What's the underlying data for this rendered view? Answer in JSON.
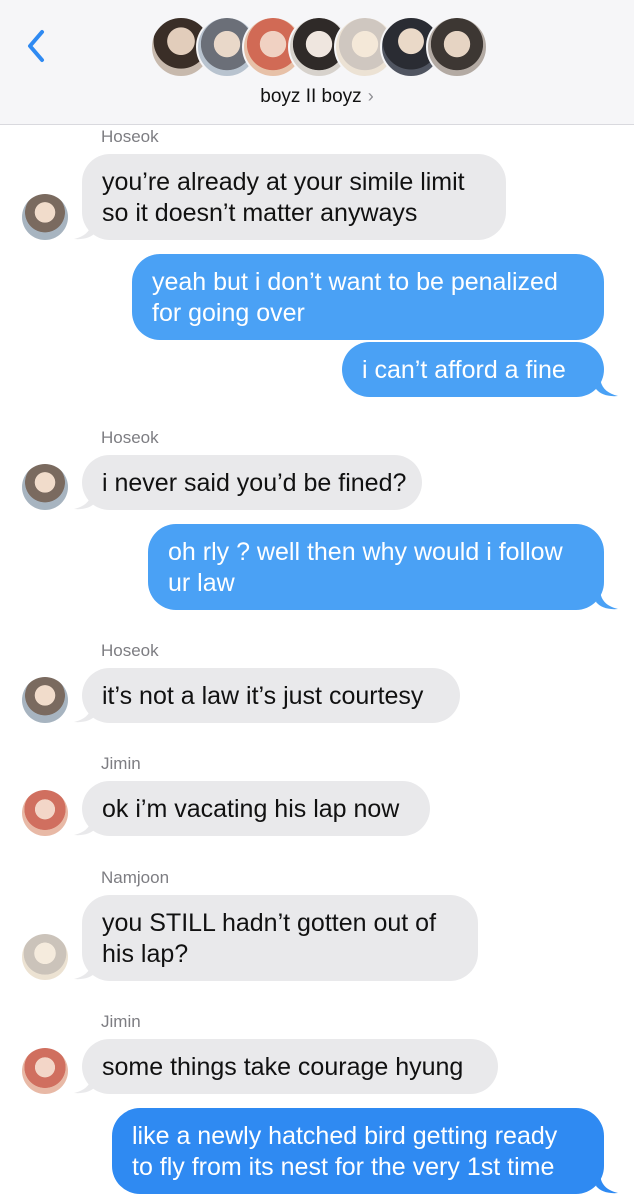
{
  "header": {
    "group_name": "boyz II boyz",
    "chevron": "›",
    "back_icon": "chevron-left-icon",
    "avatar_colors": [
      "#6b5848",
      "#a9b0b8",
      "#d99a86",
      "#c9c2bb",
      "#e8dccb",
      "#5a5c66",
      "#9a8f88"
    ]
  },
  "messages": [
    {
      "type": "in",
      "sender": "Hoseok",
      "lines": [
        "you’re already at your simile limit",
        "so it doesn’t matter anyways"
      ]
    },
    {
      "type": "out",
      "lines": [
        "yeah but i don’t want to be penalized",
        "for going over"
      ]
    },
    {
      "type": "out",
      "lines": [
        "i can’t afford a fine"
      ]
    },
    {
      "type": "in",
      "sender": "Hoseok",
      "lines": [
        "i never said you’d be fined?"
      ]
    },
    {
      "type": "out",
      "lines": [
        "oh rly ? well then why would i follow",
        "ur law"
      ]
    },
    {
      "type": "in",
      "sender": "Hoseok",
      "lines": [
        "it’s not a law it’s just courtesy"
      ]
    },
    {
      "type": "in",
      "sender": "Jimin",
      "lines": [
        "ok i’m vacating his lap now"
      ]
    },
    {
      "type": "in",
      "sender": "Namjoon",
      "lines": [
        "you STILL hadn’t gotten out of",
        "his lap?"
      ]
    },
    {
      "type": "in",
      "sender": "Jimin",
      "lines": [
        "some things take courage hyung"
      ]
    },
    {
      "type": "out",
      "lines": [
        "like a newly hatched bird getting ready",
        "to fly from its nest for the very 1st time"
      ]
    }
  ],
  "colors": {
    "incoming_bubble": "#e9e9eb",
    "outgoing_bubble": "#4aa1f5",
    "outgoing_bubble_bottom": "#2f8af2",
    "sender_label": "#7d7d82",
    "accent": "#2f8af2"
  }
}
